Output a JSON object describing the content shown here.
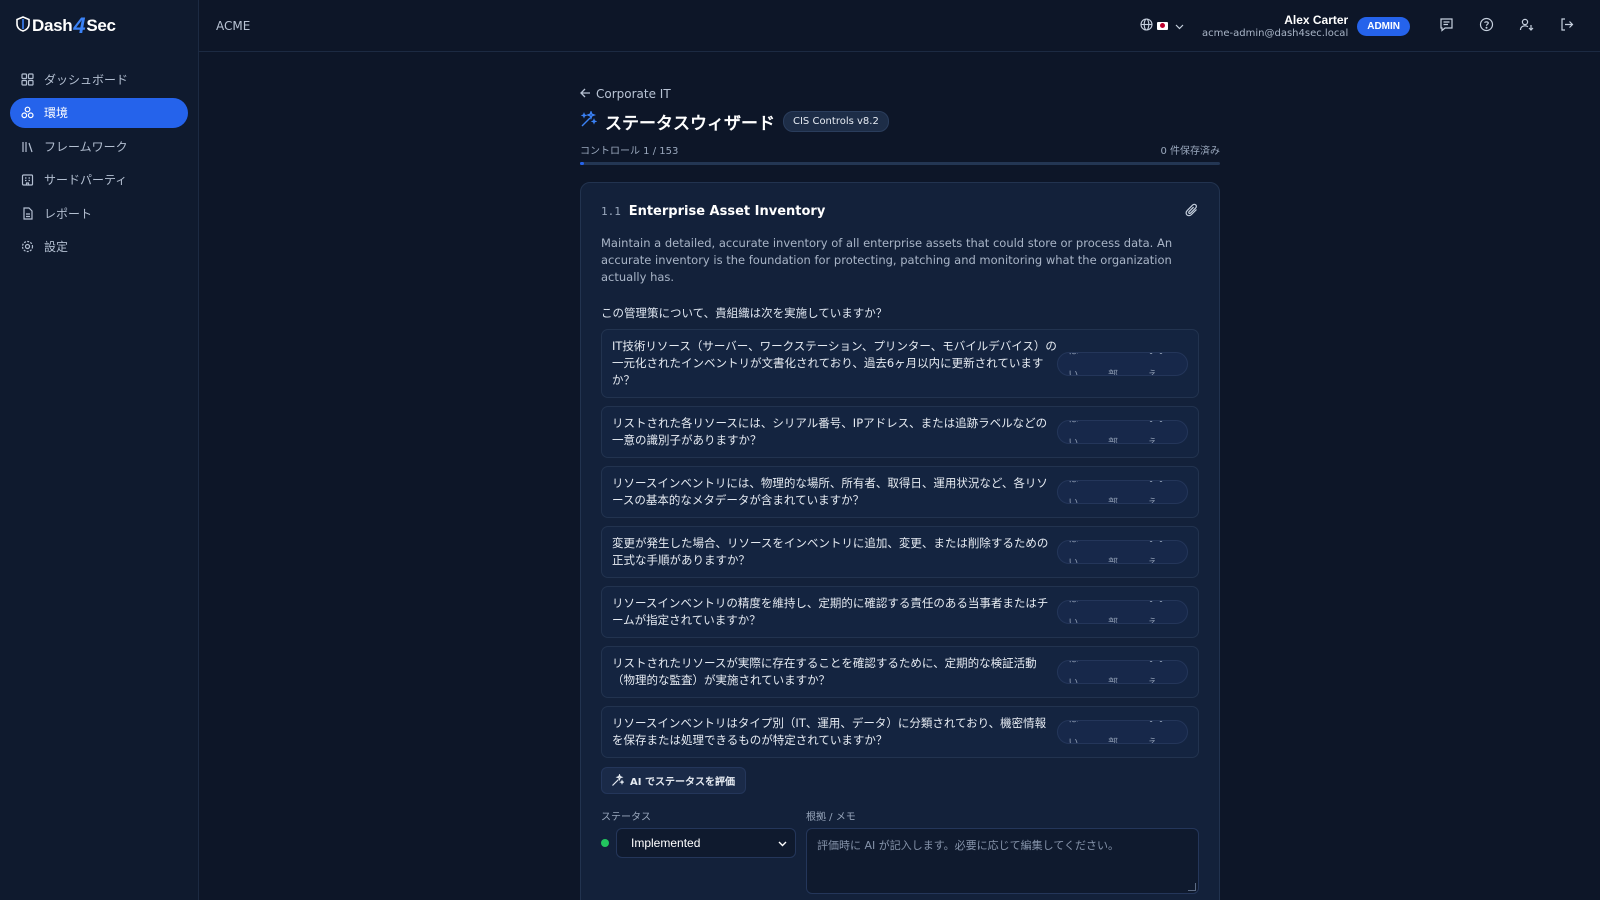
{
  "brand": {
    "name_left": "Dash",
    "name_bolt": "4",
    "name_right": "Sec"
  },
  "sidebar": {
    "items": [
      {
        "label": "ダッシュボード",
        "icon": "dashboard-icon",
        "active": false
      },
      {
        "label": "環境",
        "icon": "environment-icon",
        "active": true
      },
      {
        "label": "フレームワーク",
        "icon": "framework-icon",
        "active": false
      },
      {
        "label": "サードパーティ",
        "icon": "third-party-icon",
        "active": false
      },
      {
        "label": "レポート",
        "icon": "report-icon",
        "active": false
      },
      {
        "label": "設定",
        "icon": "settings-icon",
        "active": false
      }
    ]
  },
  "header": {
    "org": "ACME",
    "user_name": "Alex Carter",
    "user_email": "acme-admin@dash4sec.local",
    "role_badge": "ADMIN"
  },
  "main": {
    "back_label": "Corporate IT",
    "title": "ステータスウィザード",
    "framework_badge": "CIS Controls v8.2",
    "progress_label": "コントロール 1 / 153",
    "saved_label": "0 件保存済み",
    "progress_fraction": 0.0065
  },
  "control": {
    "id": "1.1",
    "title": "Enterprise Asset Inventory",
    "description": "Maintain a detailed, accurate inventory of all enterprise assets that could store or process data. An accurate inventory is the foundation for protecting, patching and monitoring what the organization actually has.",
    "question_prompt": "この管理策について、貴組織は次を実施していますか？",
    "answer_options": {
      "yes": "はい",
      "partial": "一部",
      "no": "いいえ"
    },
    "questions": [
      "IT技術リソース（サーバー、ワークステーション、プリンター、モバイルデバイス）の一元化されたインベントリが文書化されており、過去6ヶ月以内に更新されていますか？",
      "リストされた各リソースには、シリアル番号、IPアドレス、または追跡ラベルなどの一意の識別子がありますか？",
      "リソースインベントリには、物理的な場所、所有者、取得日、運用状況など、各リソースの基本的なメタデータが含まれていますか？",
      "変更が発生した場合、リソースをインベントリに追加、変更、または削除するための正式な手順がありますか？",
      "リソースインベントリの精度を維持し、定期的に確認する責任のある当事者またはチームが指定されていますか？",
      "リストされたリソースが実際に存在することを確認するために、定期的な検証活動（物理的な監査）が実施されていますか？",
      "リソースインベントリはタイプ別（IT、運用、データ）に分類されており、機密情報を保存または処理できるものが特定されていますか？"
    ],
    "ai_button": "AI でステータスを評価",
    "status_label": "ステータス",
    "status_value": "Implemented",
    "status_color": "#22c55e",
    "notes_label": "根拠 / メモ",
    "notes_placeholder": "評価時に AI が記入します。必要に応じて編集してください。"
  },
  "colors": {
    "accent": "#2563eb",
    "background": "#0d1628",
    "card": "#13213a"
  }
}
